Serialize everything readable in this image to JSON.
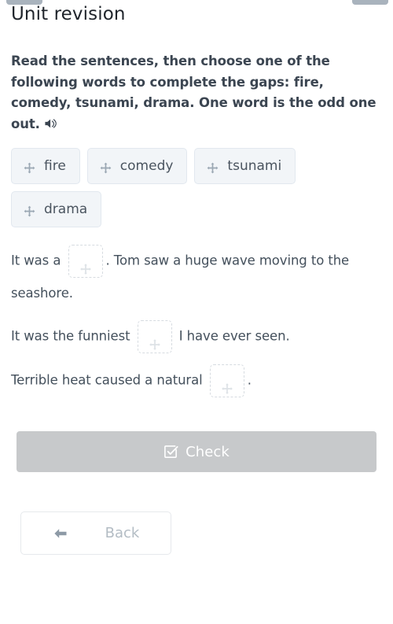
{
  "window": {
    "top_tabs": [
      "",
      ""
    ]
  },
  "header": {
    "title": "Unit revision"
  },
  "instruction": {
    "text": "Read the sentences, then choose one of the following words to complete the gaps: fire, comedy, tsunami, drama. One word is the odd one out.",
    "audio_icon": "speaker-icon"
  },
  "word_bank": {
    "drag_icon": "move-icon",
    "chips": [
      {
        "label": "fire"
      },
      {
        "label": "comedy"
      },
      {
        "label": "tsunami"
      },
      {
        "label": "drama"
      }
    ]
  },
  "sentences": [
    {
      "id": "sentence-1",
      "before": "It was a",
      "blank_value": "",
      "after": ". Tom saw a huge wave moving to the seashore."
    },
    {
      "id": "sentence-2",
      "before": "It was the funniest",
      "blank_value": "",
      "after": "I have ever seen."
    },
    {
      "id": "sentence-3",
      "before": "Terrible heat caused a natural",
      "blank_value": "",
      "after": "."
    }
  ],
  "actions": {
    "check_label": "Check",
    "check_icon": "checkbox-checked-icon",
    "check_enabled": false,
    "back_label": "Back",
    "back_icon": "arrow-left-icon"
  },
  "colors": {
    "text_primary": "#3b4551",
    "text_body": "#44505c",
    "chip_bg": "#f2f5f8",
    "chip_border": "#e2e8ef",
    "dropzone_border": "#d6dbe0",
    "check_disabled_bg": "#c7c9cb",
    "back_text": "#b3bcc4",
    "icon_grey": "#9aa7b3"
  }
}
